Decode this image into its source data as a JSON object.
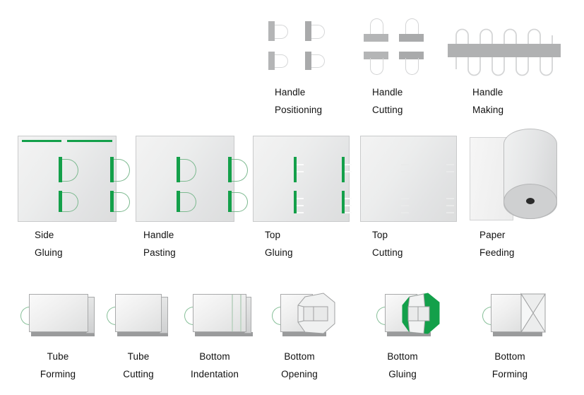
{
  "page": {
    "background": "#ffffff",
    "accent_green": "#13a04a",
    "loop_green": "#7cb98f",
    "gray": "#b4b5b6",
    "text_color": "#111111"
  },
  "rows": [
    {
      "name": "row-top",
      "items": [
        {
          "id": "handle-positioning",
          "icon": "handle-positioning-icon",
          "line1": "Handle",
          "line2": "Positioning"
        },
        {
          "id": "handle-cutting",
          "icon": "handle-cutting-icon",
          "line1": "Handle",
          "line2": "Cutting"
        },
        {
          "id": "handle-making",
          "icon": "handle-making-icon",
          "line1": "Handle",
          "line2": "Making"
        }
      ]
    },
    {
      "name": "row-middle",
      "items": [
        {
          "id": "side-gluing",
          "icon": "side-gluing-icon",
          "line1": "Side",
          "line2": "Gluing"
        },
        {
          "id": "handle-pasting",
          "icon": "handle-pasting-icon",
          "line1": "Handle",
          "line2": "Pasting"
        },
        {
          "id": "top-gluing",
          "icon": "top-gluing-icon",
          "line1": "Top",
          "line2": "Gluing"
        },
        {
          "id": "top-cutting",
          "icon": "top-cutting-icon",
          "line1": "Top",
          "line2": "Cutting"
        },
        {
          "id": "paper-feeding",
          "icon": "paper-feeding-icon",
          "line1": "Paper",
          "line2": "Feeding"
        }
      ]
    },
    {
      "name": "row-bottom",
      "items": [
        {
          "id": "tube-forming",
          "icon": "tube-forming-icon",
          "line1": "Tube",
          "line2": "Forming"
        },
        {
          "id": "tube-cutting",
          "icon": "tube-cutting-icon",
          "line1": "Tube",
          "line2": "Cutting"
        },
        {
          "id": "bottom-indentation",
          "icon": "bottom-indentation-icon",
          "line1": "Bottom",
          "line2": "Indentation"
        },
        {
          "id": "bottom-opening",
          "icon": "bottom-opening-icon",
          "line1": "Bottom",
          "line2": "Opening"
        },
        {
          "id": "bottom-gluing",
          "icon": "bottom-gluing-icon",
          "line1": "Bottom",
          "line2": "Gluing"
        },
        {
          "id": "bottom-forming",
          "icon": "bottom-forming-icon",
          "line1": "Bottom",
          "line2": "Forming"
        }
      ]
    }
  ]
}
